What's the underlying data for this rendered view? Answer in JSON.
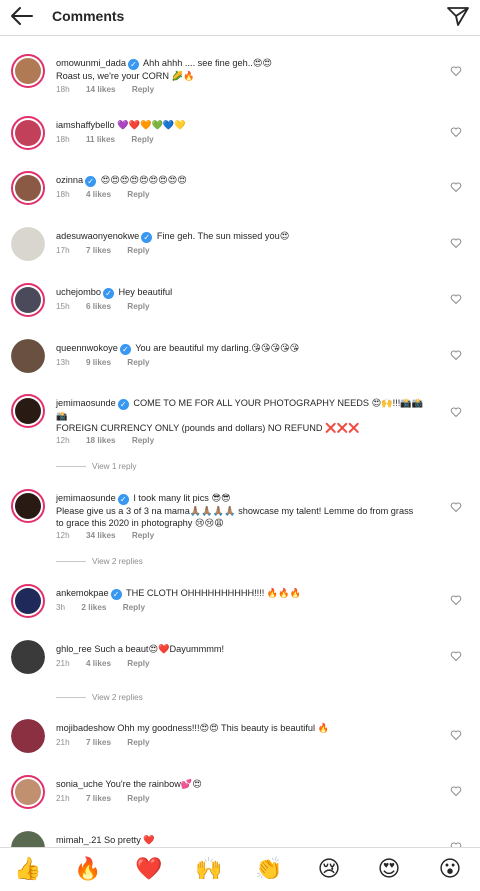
{
  "header": {
    "title": "Comments"
  },
  "comments": [
    {
      "username": "omowunmi_dada",
      "verified": true,
      "text": "Ahh ahhh .... see fine geh..😍😍",
      "text2": "Roast us, we're your CORN 🌽🔥",
      "time": "18h",
      "likes": "14 likes",
      "reply": "Reply",
      "avatar_color": "#b07a55"
    },
    {
      "username": "iamshaffybello",
      "verified": false,
      "text": "💜❤️🧡💚💙💛",
      "time": "18h",
      "likes": "11 likes",
      "reply": "Reply",
      "avatar_color": "#c2405a"
    },
    {
      "username": "ozinna",
      "verified": true,
      "text": "😍😍😍😍😍😍😍😍😍",
      "time": "18h",
      "likes": "4 likes",
      "reply": "Reply",
      "avatar_color": "#8a5a45"
    },
    {
      "username": "adesuwaonyenokwe",
      "verified": true,
      "text": "Fine geh. The sun missed you😍",
      "time": "17h",
      "likes": "7 likes",
      "reply": "Reply",
      "avatar_color": "#d9d6d0"
    },
    {
      "username": "uchejombo",
      "verified": true,
      "text": "Hey beautiful",
      "time": "15h",
      "likes": "6 likes",
      "reply": "Reply",
      "avatar_color": "#4a4a5a"
    },
    {
      "username": "queennwokoye",
      "verified": true,
      "text": "You are beautiful my darling.😘😘😘😘😘",
      "time": "13h",
      "likes": "9 likes",
      "reply": "Reply",
      "avatar_color": "#6a5040"
    },
    {
      "username": "jemimaosunde",
      "verified": true,
      "text": "COME TO ME FOR ALL YOUR PHOTOGRAPHY NEEDS 😍🙌!!!📸📸",
      "text2": "📸",
      "text3": "FOREIGN CURRENCY ONLY (pounds and dollars) NO REFUND ❌❌❌",
      "time": "12h",
      "likes": "18 likes",
      "reply": "Reply",
      "avatar_color": "#2a1a14"
    },
    {
      "username": "jemimaosunde",
      "verified": true,
      "text": "I took many lit pics 😎😎",
      "text2": "Please give us a 3 of 3 na mama🙏🏽🙏🏽🙏🏽🙏🏽 showcase my talent! Lemme do from grass",
      "text3": "to grace this 2020 in photography 😢😢😩",
      "time": "12h",
      "likes": "34 likes",
      "reply": "Reply",
      "avatar_color": "#2a1a14"
    },
    {
      "username": "ankemokpae",
      "verified": true,
      "text": "THE CLOTH OHHHHHHHHHH!!!! 🔥🔥🔥",
      "time": "3h",
      "likes": "2 likes",
      "reply": "Reply",
      "avatar_color": "#1f2a5a"
    },
    {
      "username": "ghlo_ree",
      "verified": false,
      "text": "Such a beaut😍❤️Dayummmm!",
      "time": "21h",
      "likes": "4 likes",
      "reply": "Reply",
      "avatar_color": "#3a3a3a"
    },
    {
      "username": "mojibadeshow",
      "verified": false,
      "text": "Ohh my goodness!!!😍😍 This beauty is beautiful 🔥",
      "time": "21h",
      "likes": "7 likes",
      "reply": "Reply",
      "avatar_color": "#8a3040"
    },
    {
      "username": "sonia_uche",
      "verified": false,
      "text": "You're the rainbow💕😍",
      "time": "21h",
      "likes": "7 likes",
      "reply": "Reply",
      "avatar_color": "#c09070"
    },
    {
      "username": "mimah_.21",
      "verified": false,
      "text": "So pretty ❤️",
      "avatar_color": "#5a6a50"
    }
  ],
  "view_replies": [
    "View 1 reply",
    "View 2 replies",
    "View 2 replies"
  ],
  "reactions": [
    "👍",
    "🔥",
    "❤️",
    "🙌",
    "👏",
    "😢",
    "😍",
    "😮"
  ]
}
